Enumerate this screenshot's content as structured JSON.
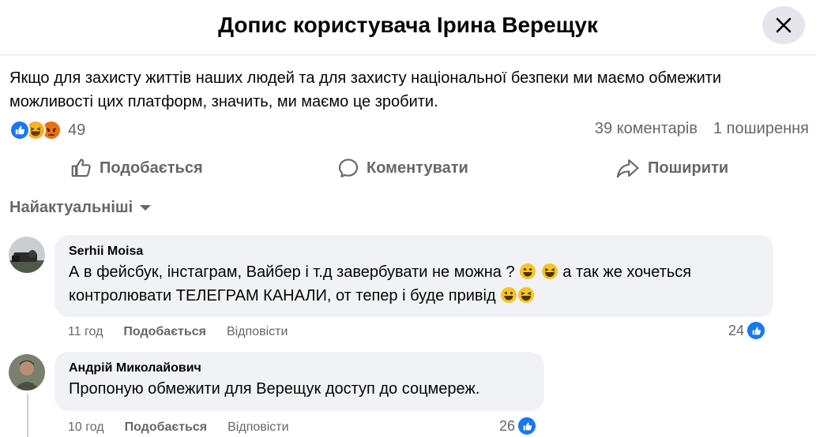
{
  "header": {
    "title": "Допис користувача Ірина Верещук"
  },
  "post": {
    "text": "Якщо для захисту життів наших людей та для захисту національної безпеки ми маємо обмежити можливості цих платформ, значить, ми маємо це зробити."
  },
  "stats": {
    "reaction_count": "49",
    "comments": "39 коментарів",
    "shares": "1 поширення",
    "reactions": [
      "like-icon",
      "laugh-icon",
      "angry-icon"
    ]
  },
  "actions": {
    "like": "Подобається",
    "comment": "Коментувати",
    "share": "Поширити"
  },
  "sort": {
    "label": "Найактуальніші"
  },
  "comments": [
    {
      "author": "Serhii Moisa",
      "text_1": "А в фейсбук, інстаграм, Вайбер і т.д завербувати не можна ?",
      "text_2": "а так же хочеться контролювати ТЕЛЕГРАМ КАНАЛИ, от тепер і буде привід",
      "time": "11 год",
      "like_label": "Подобається",
      "reply_label": "Відповісти",
      "likes": "24"
    },
    {
      "author": "Андрій Миколайович",
      "text_1": "Пропоную обмежити для Верещук доступ до соцмереж.",
      "time": "10 год",
      "like_label": "Подобається",
      "reply_label": "Відповісти",
      "likes": "26"
    }
  ],
  "colors": {
    "accent": "#1877f2",
    "secondary_text": "#65676b",
    "bubble": "#f0f2f5",
    "angry": "#e9710f",
    "emoji_yellow": "#f7b125"
  }
}
